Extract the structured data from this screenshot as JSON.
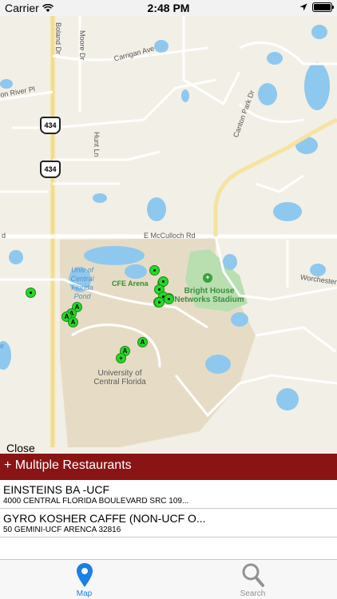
{
  "status_bar": {
    "carrier": "Carrier",
    "time": "2:48 PM",
    "battery_level": 1.0
  },
  "map": {
    "road_labels": {
      "boland": "Boland Dr",
      "moore": "Moore Dr",
      "carrigan": "Carrigan Ave",
      "canton_river": "on River Pl",
      "hunt": "Hunt Ln",
      "mcculloch": "E McCulloch Rd",
      "mcculloch_left": "d",
      "worchester": "Worchester",
      "canton_park": "Canton Park Dr",
      "shield_1": "434",
      "shield_2": "434"
    },
    "place_labels": {
      "pond": "Univ of Central Florida Pond",
      "arena": "CFE Arena",
      "stadium": "Bright House Networks Stadium",
      "university": "University of Central Florida",
      "lake_fragment": "e"
    },
    "pins": [
      "",
      "",
      "",
      "A",
      "A",
      "A",
      "A",
      "",
      "",
      "",
      "",
      "A",
      "A",
      "+",
      "",
      ""
    ]
  },
  "close_label": "Close",
  "multi_header": "+ Multiple Restaurants",
  "restaurants": [
    {
      "name": "EINSTEINS BA -UCF",
      "address": "4000 CENTRAL FLORIDA BOULEVARD SRC 109..."
    },
    {
      "name": "GYRO KOSHER CAFFE (NON-UCF O...",
      "address": "50 GEMINI-UCF ARENCA 32816"
    }
  ],
  "tabs": [
    {
      "label": "Map",
      "icon": "map-pin-icon",
      "active": true
    },
    {
      "label": "Search",
      "icon": "magnifier-icon",
      "active": false
    }
  ],
  "colors": {
    "accent": "#1a7fe6",
    "header_bar": "#8a1414",
    "pin": "#29d629",
    "water": "#8ec8ee",
    "campus": "#e6dcc6",
    "park": "#b9deb0"
  }
}
